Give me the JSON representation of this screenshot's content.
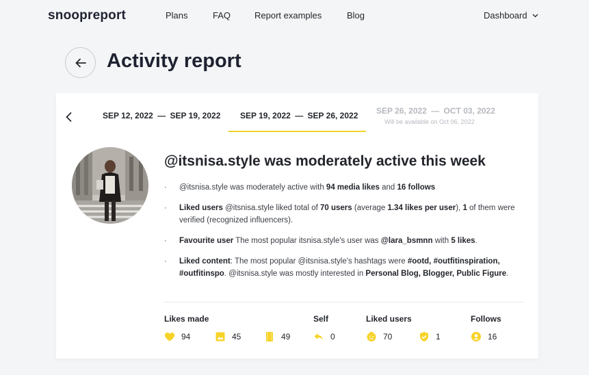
{
  "nav": {
    "logo": "snoopreport",
    "links": [
      "Plans",
      "FAQ",
      "Report examples",
      "Blog"
    ],
    "dashboard": "Dashboard"
  },
  "page": {
    "title": "Activity report"
  },
  "weeks": [
    {
      "start": "SEP 12, 2022",
      "end": "SEP 19, 2022",
      "sep": "—"
    },
    {
      "start": "SEP 19, 2022",
      "end": "SEP 26, 2022",
      "sep": "—"
    },
    {
      "start": "SEP 26, 2022",
      "end": "OCT 03, 2022",
      "sep": "—",
      "note": "Will be available on Oct 06, 2022"
    }
  ],
  "report": {
    "headline": "@itsnisa.style was moderately active this week",
    "b1": {
      "t1": "@itsnisa.style was moderately active with ",
      "likes": "94 media likes",
      "t2": " and ",
      "follows": "16 follows"
    },
    "b2": {
      "label": "Liked users",
      "t1": " @itsnisa.style liked total of ",
      "users": "70 users",
      "t2": " (average ",
      "avg": "1.34 likes per user",
      "t3": "), ",
      "verified": "1",
      "t4": " of them were verified (recognized influencers)."
    },
    "b3": {
      "label": "Favourite user",
      "t1": " The most popular itsnisa.style's user was ",
      "user": "@lara_bsmnn",
      "t2": " with ",
      "likes": "5 likes",
      "t3": "."
    },
    "b4": {
      "label": "Liked content",
      "t1": ": The most popular @itsnisa.style's hashtags were ",
      "tags": "#ootd, #outfitinspiration, #outfitinspo",
      "t2": ". @itsnisa.style was mostly interested in ",
      "cats": "Personal Blog, Blogger, Public Figure",
      "t3": "."
    }
  },
  "stats": {
    "headers": {
      "likes_made": "Likes made",
      "self": "Self",
      "liked_users": "Liked users",
      "follows": "Follows"
    },
    "items": [
      {
        "icon": "heart-icon",
        "value": "94"
      },
      {
        "icon": "image-icon",
        "value": "45"
      },
      {
        "icon": "film-icon",
        "value": "49"
      },
      {
        "icon": "reply-icon",
        "value": "0"
      },
      {
        "icon": "smiley-icon",
        "value": "70"
      },
      {
        "icon": "shield-check-icon",
        "value": "1"
      },
      {
        "icon": "user-icon",
        "value": "16"
      }
    ]
  },
  "colors": {
    "accent": "#f2d22e",
    "icon": "#f7d32a",
    "bg": "#f4f5f7",
    "text": "#22252b"
  }
}
